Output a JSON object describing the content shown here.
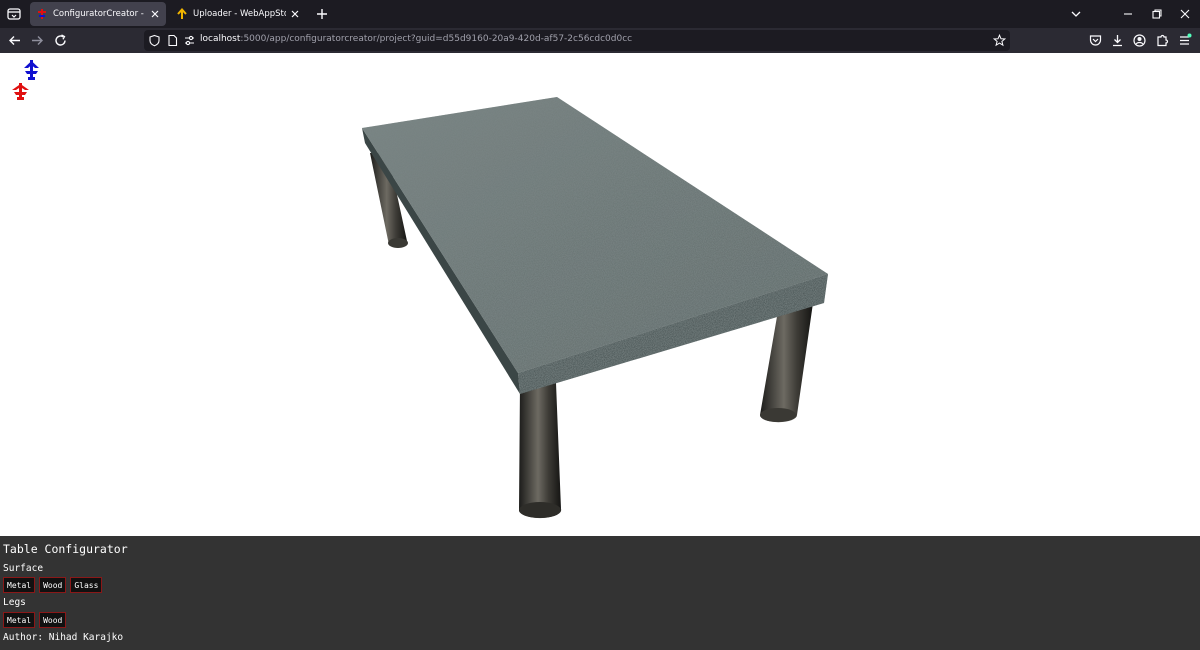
{
  "browser": {
    "tabs": [
      {
        "title": "ConfiguratorCreator - WebAppStore",
        "active": true
      },
      {
        "title": "Uploader - WebAppStore",
        "active": false
      }
    ],
    "url": {
      "host": "localhost",
      "path": ":5000/app/configuratorcreator/project?guid=d55d9160-20a9-420d-af57-2c56cdc0d0cc"
    }
  },
  "icons": {
    "tab_list": "tab-list-icon",
    "back": "back-arrow-icon",
    "forward": "forward-arrow-icon",
    "reload": "reload-icon",
    "shield": "shield-icon",
    "page": "page-icon",
    "permissions": "permissions-icon",
    "bookmark": "star-icon",
    "pocket": "pocket-icon",
    "downloads": "download-icon",
    "account": "account-icon",
    "extensions": "puzzle-icon",
    "menu": "hamburger-menu-icon"
  },
  "colors": {
    "panel_bg": "#333333",
    "button_border": "#8a1818",
    "gizmo_blue": "#1010d0",
    "gizmo_red": "#e01010"
  },
  "configurator": {
    "title": "Table Configurator",
    "sections": [
      {
        "label": "Surface",
        "options": [
          "Metal",
          "Wood",
          "Glass"
        ]
      },
      {
        "label": "Legs",
        "options": [
          "Metal",
          "Wood"
        ]
      }
    ],
    "author": "Author: Nihad Karajko"
  }
}
